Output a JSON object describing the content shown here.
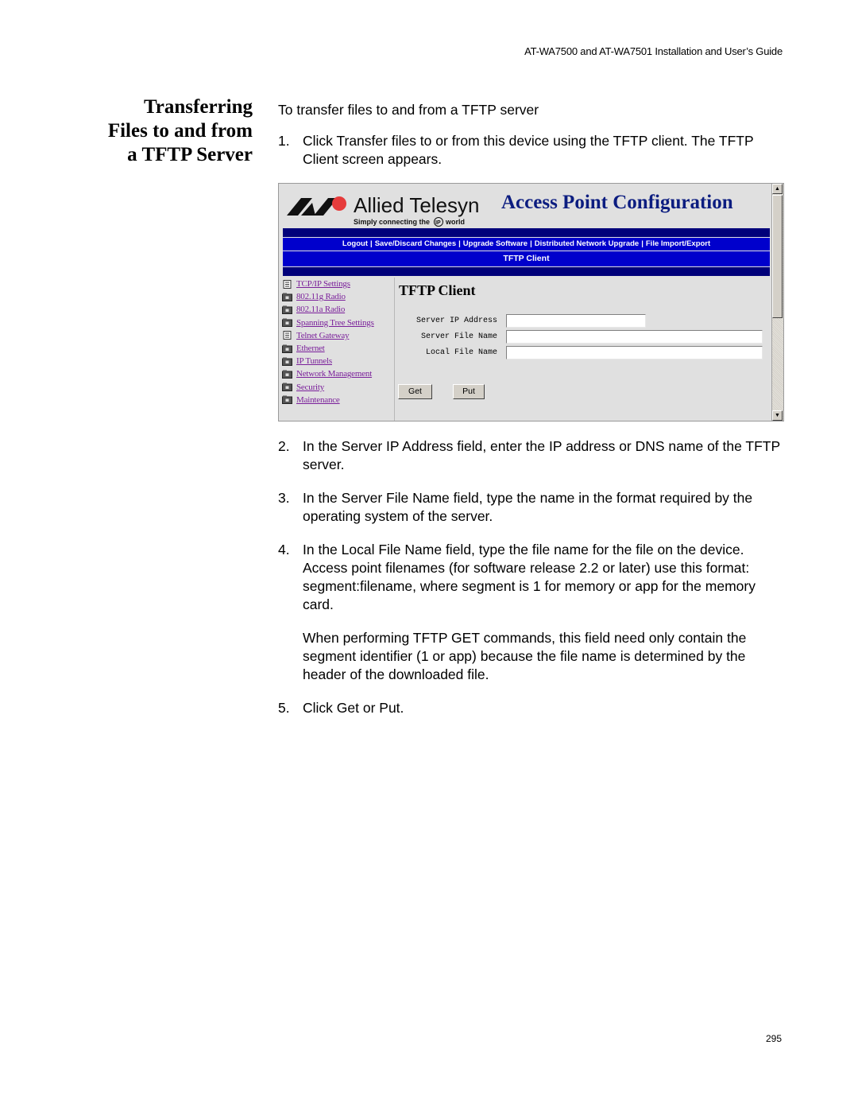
{
  "header": {
    "running_title": "AT-WA7500 and AT-WA7501 Installation and User’s Guide"
  },
  "section": {
    "title_lines": [
      "Transferring",
      "Files to and from",
      "a TFTP Server"
    ]
  },
  "body": {
    "intro": "To transfer files to and from a TFTP server",
    "steps": [
      {
        "num": "1.",
        "text": "Click Transfer files to or from this device using the TFTP client. The TFTP Client screen appears."
      },
      {
        "num": "2.",
        "text": "In the Server IP Address field, enter the IP address or DNS name of the TFTP server."
      },
      {
        "num": "3.",
        "text": "In the Server File Name field, type the name in the format required by the operating system of the server."
      },
      {
        "num": "4.",
        "text": "In the Local File Name field, type the file name for the file on the device. Access point filenames (for software release 2.2 or later) use this format: segment:filename, where segment is 1 for memory or app for the memory card."
      },
      {
        "num": "5.",
        "text": "Click Get or Put."
      }
    ],
    "note": "When performing TFTP GET commands, this field need only contain the segment identifier (1 or app) because the file name is determined by the header of the downloaded file."
  },
  "screenshot": {
    "brand": {
      "name": "Allied Telesyn",
      "tagline_pre": "Simply connecting the",
      "tagline_ip": "IP",
      "tagline_post": "world",
      "logo_icon": "allied-telesyn-logo"
    },
    "app_title": "Access Point Configuration",
    "nav": [
      "Logout",
      "Save/Discard Changes",
      "Upgrade Software",
      "Distributed Network Upgrade",
      "File Import/Export"
    ],
    "breadcrumb": "TFTP Client",
    "sidebar": [
      {
        "label": "TCP/IP Settings",
        "icon": "document-icon"
      },
      {
        "label": "802.11g Radio",
        "icon": "folder-icon"
      },
      {
        "label": "802.11a Radio",
        "icon": "folder-icon"
      },
      {
        "label": "Spanning Tree Settings",
        "icon": "folder-icon"
      },
      {
        "label": "Telnet Gateway",
        "icon": "document-icon"
      },
      {
        "label": "Ethernet",
        "icon": "folder-icon"
      },
      {
        "label": "IP Tunnels",
        "icon": "folder-icon"
      },
      {
        "label": "Network Management",
        "icon": "folder-icon"
      },
      {
        "label": "Security",
        "icon": "folder-icon"
      },
      {
        "label": "Maintenance",
        "icon": "folder-icon"
      }
    ],
    "form": {
      "heading": "TFTP Client",
      "fields": [
        {
          "label": "Server IP Address",
          "value": ""
        },
        {
          "label": "Server File Name",
          "value": ""
        },
        {
          "label": "Local File Name",
          "value": ""
        }
      ],
      "get_label": "Get",
      "put_label": "Put"
    },
    "colors": {
      "nav_bar": "#0000cc",
      "nav_bar_dark": "#00007a",
      "title": "#0c1d80",
      "link": "#7a1f9a"
    }
  },
  "footer": {
    "page_number": "295"
  }
}
